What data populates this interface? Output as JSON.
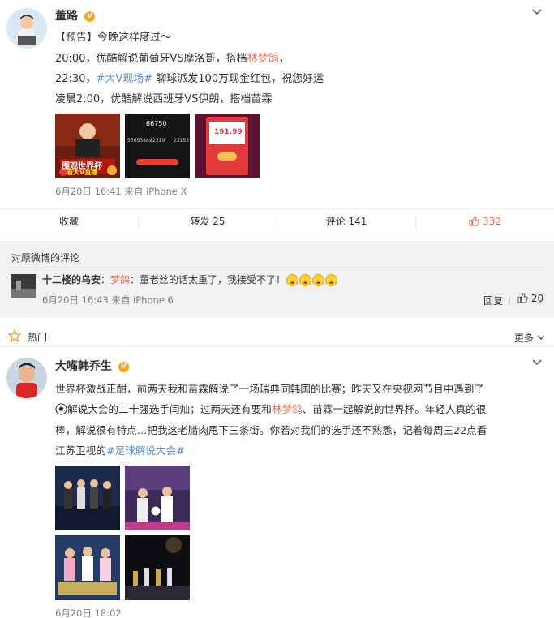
{
  "post": {
    "author": "董路",
    "badge": "V",
    "lines": {
      "l1": "【预告】今晚这样度过～",
      "l2a": "20:00，优酷解说葡萄牙VS摩洛哥，搭档",
      "l2link": "林梦鸽",
      "l2b": "，",
      "l3a": "22:30，",
      "l3topic": "#大V现场#",
      "l3b": " 聊球派发100万现金红包，祝您好运",
      "l4": "凌晨2:00，优酷解说西班牙VS伊朗，搭档苗霖"
    },
    "images": {
      "img1_caption": "围观世界杯",
      "img1_caption2": "看大V直播",
      "img2_big": "66750",
      "img2_stats": [
        "53693889",
        "2319",
        "22155"
      ],
      "img3_amount": "191.99"
    },
    "meta": "6月20日 16:41 来自 iPhone X"
  },
  "toolbar": {
    "favorite": "收藏",
    "repost": "转发 25",
    "comment": "评论 141",
    "like": "332"
  },
  "comments_header": "对原微博的评论",
  "comment": {
    "user": "十二楼的乌安",
    "colon": "：",
    "mention": "梦鸽",
    "text": "：董老丝的话太重了，我接受不了！",
    "meta": "6月20日 16:43 来自 iPhone 6",
    "reply": "回复",
    "likes": "20"
  },
  "hot": {
    "label": "热门",
    "more": "更多"
  },
  "post2": {
    "author": "大嘴韩乔生",
    "badge": "V",
    "l1": "世界杯激战正酣，前两天我和苗霖解说了一场瑞典同韩国的比赛；昨天又在央视网节目中遇到了",
    "l2a": "解说大会的二十强选手闫灿；过两天还有要和",
    "l2link": "林梦鸽",
    "l2b": "、苗霖一起解说的世界杯。年轻人真的很",
    "l3": "棒，解说很有特点…把我这老腊肉甩下三条街。你若对我们的选手还不熟悉，记着每周三22点看",
    "l4a": "江苏卫视的",
    "l4topic": "#足球解说大会#",
    "meta": "6月20日 18:02"
  },
  "colors": {
    "accent_orange": "#eb7350",
    "topic_blue": "#5b8bd4",
    "meta_gray": "#808080",
    "comment_bg": "#f2f2f5"
  },
  "icons": [
    "chevron-down-icon",
    "thumbs-up-icon",
    "hot-star-icon",
    "soccer-ball-icon",
    "crying-emoji-icon"
  ]
}
